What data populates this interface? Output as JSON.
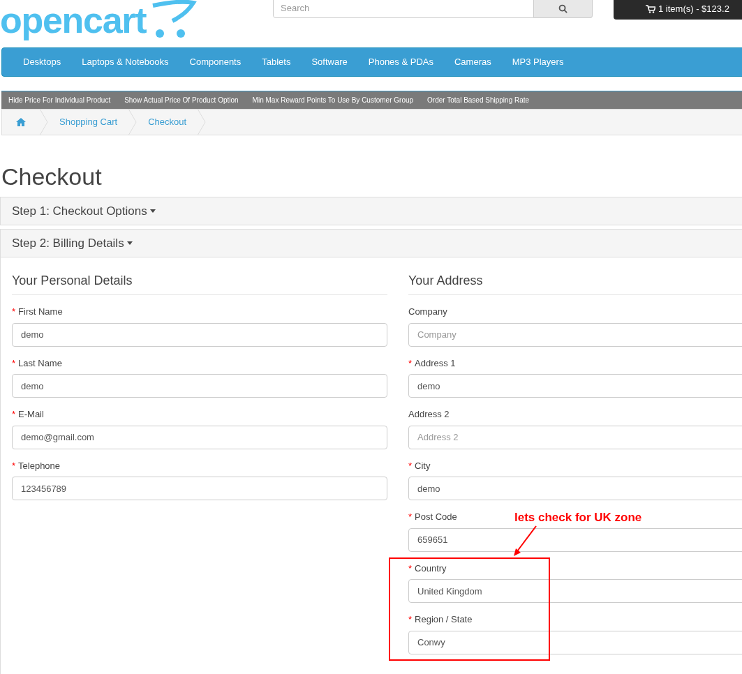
{
  "header": {
    "logo": "opencart",
    "search": {
      "placeholder": "Search"
    },
    "cart": "1 item(s) - $123.2"
  },
  "menu": [
    "Desktops",
    "Laptops & Notebooks",
    "Components",
    "Tablets",
    "Software",
    "Phones & PDAs",
    "Cameras",
    "MP3 Players"
  ],
  "promo_links": [
    "Hide Price For Individual Product",
    "Show Actual Price Of Product Option",
    "Min Max Reward Points To Use By Customer Group",
    "Order Total Based Shipping Rate"
  ],
  "breadcrumb": [
    "Shopping Cart",
    "Checkout"
  ],
  "title": "Checkout",
  "steps": [
    {
      "label": "Step 1: Checkout Options",
      "expanded": false
    },
    {
      "label": "Step 2: Billing Details",
      "expanded": true
    }
  ],
  "columns": [
    {
      "heading": "Your Personal Details",
      "fields": [
        {
          "label": "First Name",
          "marker": "*",
          "value": "demo"
        },
        {
          "label": "Last Name",
          "marker": "*",
          "value": "demo"
        },
        {
          "label": "E-Mail",
          "marker": "*",
          "value": "demo@gmail.com"
        },
        {
          "label": "Telephone",
          "marker": "*",
          "value": "123456789"
        }
      ]
    },
    {
      "heading": "Your Address",
      "fields": [
        {
          "label": "Company",
          "placeholder": "Company"
        },
        {
          "label": "Address 1",
          "marker": "*",
          "value": "demo"
        },
        {
          "label": "Address 2",
          "placeholder": "Address 2"
        },
        {
          "label": "City",
          "marker": "*",
          "value": "demo"
        },
        {
          "label": "Post Code",
          "marker": "*",
          "value": "659651"
        },
        {
          "label": "Country",
          "marker": "*",
          "value": "United Kingdom"
        },
        {
          "label": "Region / State",
          "marker": "*",
          "value": "Conwy"
        }
      ]
    }
  ],
  "annotation": "lets check for UK zone"
}
